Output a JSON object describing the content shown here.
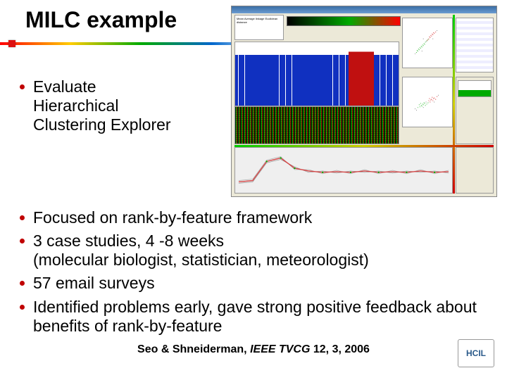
{
  "title": "MILC example",
  "bullets_top": [
    {
      "text": "Evaluate",
      "sub": "Hierarchical\nClustering Explorer"
    }
  ],
  "bullets_bottom": [
    {
      "text": "Focused on rank-by-feature framework"
    },
    {
      "text": "3 case studies, 4 -8 weeks",
      "sub": "(molecular biologist, statistician, meteorologist)"
    },
    {
      "text": "57 email surveys"
    },
    {
      "text": "Identified problems early, gave strong positive feedback about benefits of rank-by-feature"
    }
  ],
  "citation": {
    "authors": "Seo & Shneiderman, ",
    "venue": "IEEE TVCG ",
    "detail": "12, 3, 2006"
  },
  "logo_text": "HCIL",
  "screenshot": {
    "legend_lines": "Mean\nAverage linkage\nEuclidean distance"
  }
}
